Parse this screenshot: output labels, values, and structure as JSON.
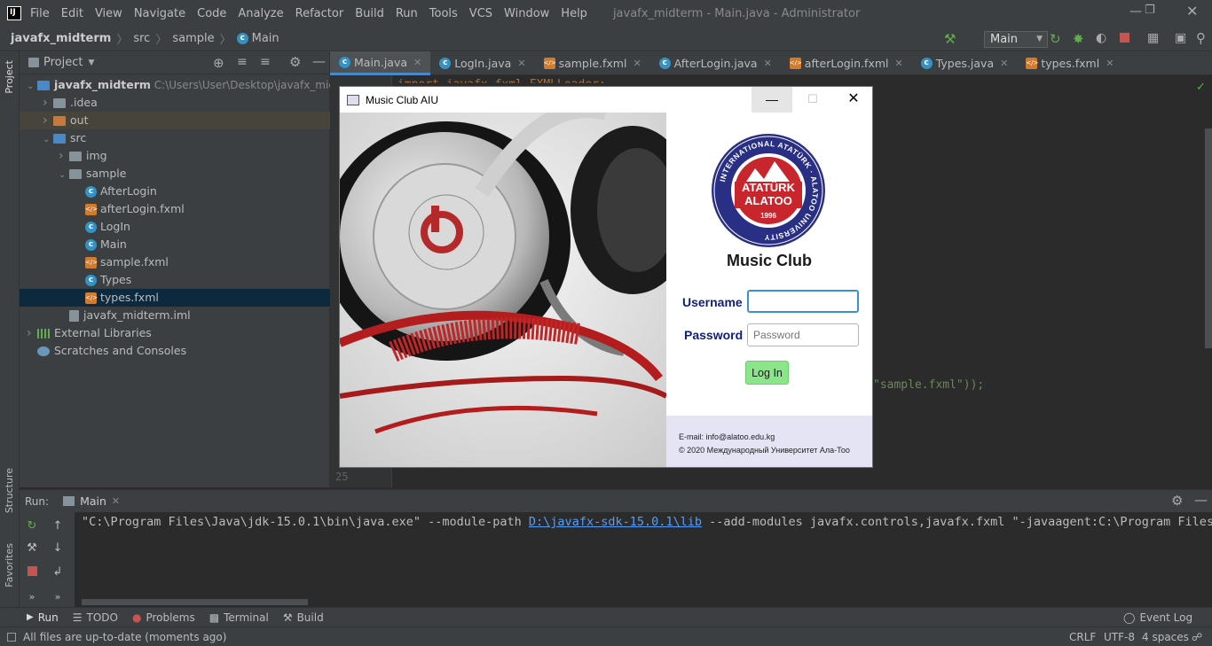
{
  "ide": {
    "window_title": "javafx_midterm - Main.java - Administrator",
    "menu": [
      "File",
      "Edit",
      "View",
      "Navigate",
      "Code",
      "Analyze",
      "Refactor",
      "Build",
      "Run",
      "Tools",
      "VCS",
      "Window",
      "Help"
    ],
    "breadcrumb": [
      "javafx_midterm",
      "src",
      "sample",
      "Main"
    ],
    "run_config": "Main",
    "project_panel": {
      "title": "Project",
      "tree": [
        {
          "label": "javafx_midterm",
          "path": "C:\\Users\\User\\Desktop\\javafx_midterm",
          "kind": "module",
          "indent": 0,
          "arrow": "down"
        },
        {
          "label": ".idea",
          "kind": "folder",
          "indent": 1,
          "arrow": "right"
        },
        {
          "label": "out",
          "kind": "folder-orange",
          "indent": 1,
          "arrow": "right"
        },
        {
          "label": "src",
          "kind": "folder-blue",
          "indent": 1,
          "arrow": "down"
        },
        {
          "label": "img",
          "kind": "folder",
          "indent": 2,
          "arrow": "right"
        },
        {
          "label": "sample",
          "kind": "folder",
          "indent": 2,
          "arrow": "down"
        },
        {
          "label": "AfterLogin",
          "kind": "class",
          "indent": 3
        },
        {
          "label": "afterLogin.fxml",
          "kind": "fxml",
          "indent": 3
        },
        {
          "label": "LogIn",
          "kind": "class",
          "indent": 3
        },
        {
          "label": "Main",
          "kind": "class",
          "indent": 3
        },
        {
          "label": "sample.fxml",
          "kind": "fxml",
          "indent": 3
        },
        {
          "label": "Types",
          "kind": "class",
          "indent": 3
        },
        {
          "label": "types.fxml",
          "kind": "fxml",
          "indent": 3
        },
        {
          "label": "javafx_midterm.iml",
          "kind": "iml",
          "indent": 2
        },
        {
          "label": "External Libraries",
          "kind": "lib",
          "indent": 0,
          "arrow": "right"
        },
        {
          "label": "Scratches and Consoles",
          "kind": "scratch",
          "indent": 0
        }
      ]
    },
    "tabs": [
      {
        "label": "Main.java",
        "kind": "class",
        "active": true
      },
      {
        "label": "LogIn.java",
        "kind": "class"
      },
      {
        "label": "sample.fxml",
        "kind": "fxml"
      },
      {
        "label": "AfterLogin.java",
        "kind": "class"
      },
      {
        "label": "afterLogin.fxml",
        "kind": "fxml"
      },
      {
        "label": "Types.java",
        "kind": "class"
      },
      {
        "label": "types.fxml",
        "kind": "fxml"
      }
    ],
    "code_visible": {
      "top_line": "import javafx.fxml.FXMLLoader;",
      "mid_fragment": "\"sample.fxml\"));",
      "last_line_number": "25"
    },
    "run_panel": {
      "label": "Run:",
      "tab": "Main",
      "command_prefix": "\"C:\\Program Files\\Java\\jdk-15.0.1\\bin\\java.exe\" --module-path ",
      "command_link": "D:\\javafx-sdk-15.0.1\\lib",
      "command_suffix": " --add-modules javafx.controls,javafx.fxml \"-javaagent:C:\\Program Files\\Je"
    },
    "bottom_tools": [
      "Run",
      "TODO",
      "Problems",
      "Terminal",
      "Build"
    ],
    "event_log": "Event Log",
    "left_strip": [
      "Project",
      "Structure",
      "Favorites"
    ],
    "status": {
      "message": "All files are up-to-date (moments ago)",
      "line_sep": "CRLF",
      "encoding": "UTF-8",
      "indent": "4 spaces"
    }
  },
  "music_app": {
    "window_title": "Music Club AIU",
    "logo_text": {
      "ring": "INTERNATIONAL ATATÜRK · ALATOO UNIVERSITY",
      "line1": "ATATÜRK",
      "line2": "ALATOO",
      "year": "1996"
    },
    "heading": "Music Club",
    "username_label": "Username",
    "username_value": "",
    "password_label": "Password",
    "password_placeholder": "Password",
    "login_button": "Log In",
    "footer_email": "E-mail: info@alatoo.edu.kg",
    "footer_copyright": "© 2020 Международный Университет Ала-Тоо"
  },
  "colors": {
    "accent": "#4a88c7",
    "heading_blue": "#0f1e7a",
    "login_green": "#8be68b",
    "footer_bg": "#e4e4f4"
  }
}
